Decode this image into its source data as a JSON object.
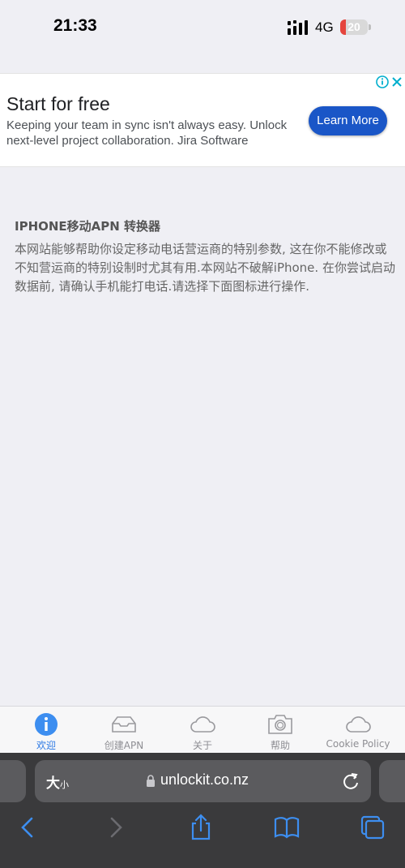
{
  "status_bar": {
    "time": "21:33",
    "network": "4G",
    "battery": "20",
    "battery_level": 0.2
  },
  "ad": {
    "title": "Start for free",
    "body": "Keeping your team in sync isn't always easy. Unlock next-level project collaboration. Jira Software",
    "button_label": "Learn More",
    "button_color": "#1a56c7"
  },
  "content": {
    "title": "IPHONE移动APN 转换器",
    "body": "本网站能够帮助你设定移动电话营运商的特别参数, 这在你不能修改或不知营运商的特别设制时尤其有用.本网站不破解iPhone. 在你尝试启动数据前, 请确认手机能打电话.请选择下面图标进行操作."
  },
  "tabs": [
    {
      "label": "欢迎",
      "icon": "info-icon",
      "active": true
    },
    {
      "label": "创建APN",
      "icon": "inbox-icon",
      "active": false
    },
    {
      "label": "关于",
      "icon": "cloud-icon",
      "active": false
    },
    {
      "label": "帮助",
      "icon": "camera-icon",
      "active": false
    },
    {
      "label": "Cookie Policy",
      "icon": "cloud-icon",
      "active": false
    }
  ],
  "safari": {
    "text_size_big": "大",
    "text_size_small": "小",
    "url": "unlockit.co.nz"
  },
  "colors": {
    "accent": "#2b78e4",
    "safari_toolbar": "#3a3a3c",
    "ios_blue": "#3d8ef0"
  }
}
